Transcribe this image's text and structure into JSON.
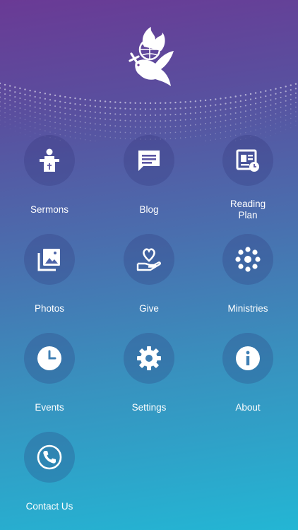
{
  "menu": {
    "sermons": "Sermons",
    "blog": "Blog",
    "reading_plan_line1": "Reading",
    "reading_plan_line2": "Plan",
    "photos": "Photos",
    "give": "Give",
    "ministries": "Ministries",
    "events": "Events",
    "settings": "Settings",
    "about": "About",
    "contact": "Contact Us"
  },
  "icons": {
    "logo": "dove-flame-globe-logo",
    "sermons": "preacher-pulpit-icon",
    "blog": "speech-bubble-icon",
    "reading_plan": "reading-plan-clock-icon",
    "photos": "photo-gallery-icon",
    "give": "heart-hand-icon",
    "ministries": "dots-circle-icon",
    "events": "clock-icon",
    "settings": "gear-icon",
    "about": "info-icon",
    "contact": "phone-icon"
  },
  "colors": {
    "gradient_top": "#6a3a95",
    "gradient_bottom": "#23b6d4",
    "icon": "#ffffff"
  }
}
